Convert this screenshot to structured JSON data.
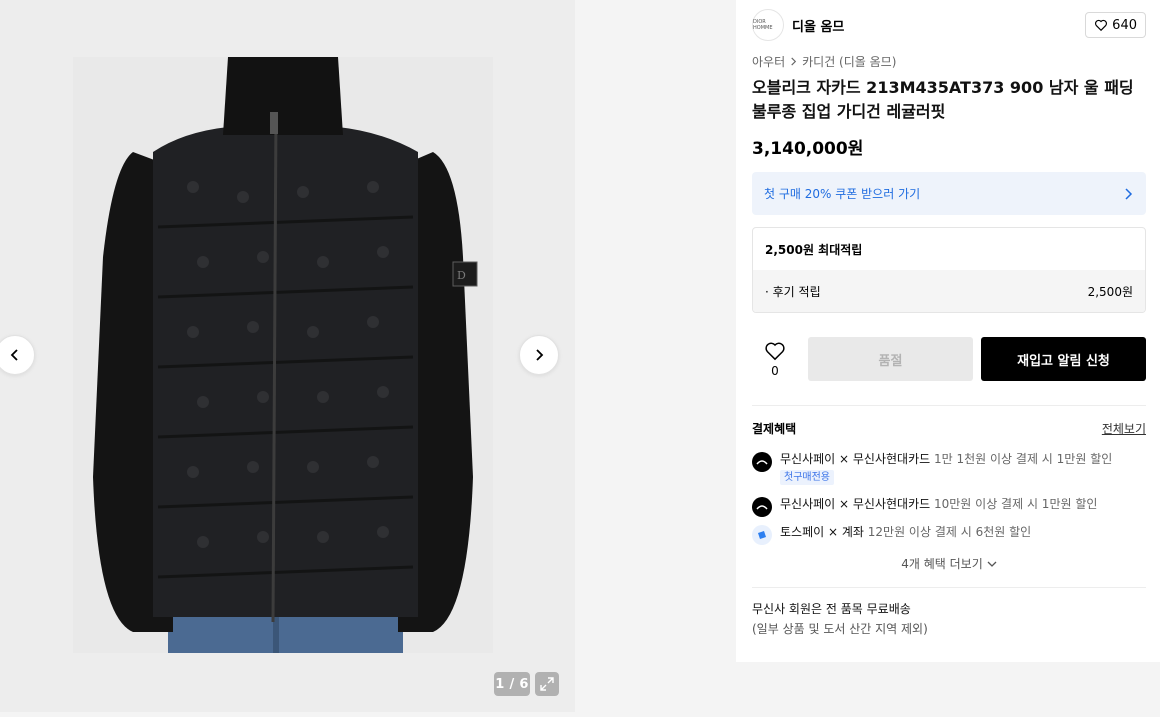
{
  "gallery": {
    "counter": "1 / 6",
    "image_alt": "black quilted knit zip-up cardigan jacket"
  },
  "brand": {
    "logo_text": "DIOR HOMME",
    "name": "디올 옴므",
    "like_count": "640"
  },
  "breadcrumb": {
    "items": [
      "아우터",
      "카디건 (디올 옴므)"
    ]
  },
  "product": {
    "title": "오블리크 자카드 213M435AT373 900 남자 울 패딩 불루종 집업 가디건 레귤러핏",
    "price": "3,140,000원"
  },
  "coupon": {
    "text": "첫 구매 20% 쿠폰 받으러 가기"
  },
  "points": {
    "max": "2,500원 최대적립",
    "review_label": "· 후기 적립",
    "review_value": "2,500원"
  },
  "actions": {
    "wish_count": "0",
    "soldout_label": "품절",
    "restock_label": "재입고 알림 신청"
  },
  "benefits": {
    "heading": "결제혜택",
    "view_all": "전체보기",
    "items": [
      {
        "partner": "무신사페이 × 무신사현대카드",
        "desc": "1만 1천원 이상 결제 시 1만원 할인",
        "tag": "첫구매전용"
      },
      {
        "partner": "무신사페이 × 무신사현대카드",
        "desc": "10만원 이상 결제 시 1만원 할인"
      },
      {
        "partner": "토스페이 × 계좌",
        "desc": "12만원 이상 결제 시 6천원 할인"
      }
    ],
    "more": "4개 혜택 더보기"
  },
  "shipping": {
    "line1": "무신사 회원은 전 품목 무료배송",
    "line2": "(일부 상품 및 도서 산간 지역 제외)"
  }
}
